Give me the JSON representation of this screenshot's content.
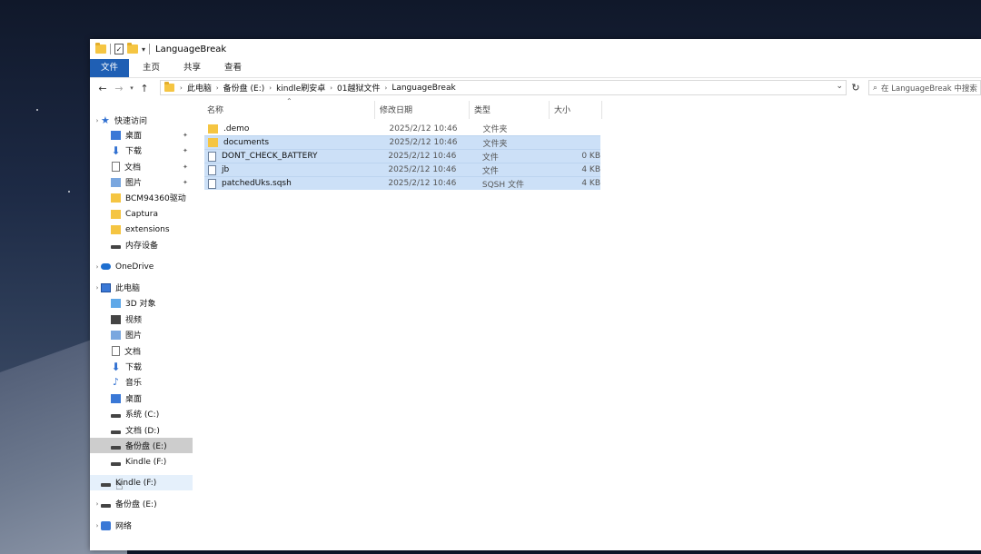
{
  "window": {
    "title": "LanguageBreak"
  },
  "ribbon": {
    "tabs": [
      "文件",
      "主页",
      "共享",
      "查看"
    ]
  },
  "address": {
    "crumbs": [
      "此电脑",
      "备份盘 (E:)",
      "kindle刷安卓",
      "01越狱文件",
      "LanguageBreak"
    ],
    "search_placeholder": "在 LanguageBreak 中搜索"
  },
  "sidebar": {
    "items": [
      {
        "label": "快速访问",
        "icon": "star-icon"
      },
      {
        "label": "桌面",
        "icon": "desktop-icon",
        "pinned": true
      },
      {
        "label": "下载",
        "icon": "download-icon",
        "pinned": true
      },
      {
        "label": "文档",
        "icon": "document-icon",
        "pinned": true
      },
      {
        "label": "图片",
        "icon": "pictures-icon",
        "pinned": true
      },
      {
        "label": "BCM94360驱动",
        "icon": "folder-icon"
      },
      {
        "label": "Captura",
        "icon": "folder-icon"
      },
      {
        "label": "extensions",
        "icon": "folder-icon"
      },
      {
        "label": "内存设备",
        "icon": "drive-icon"
      },
      {
        "label": "OneDrive",
        "icon": "cloud-icon"
      },
      {
        "label": "此电脑",
        "icon": "computer-icon"
      },
      {
        "label": "3D 对象",
        "icon": "3d-objects-icon"
      },
      {
        "label": "视频",
        "icon": "video-icon"
      },
      {
        "label": "图片",
        "icon": "pictures-icon"
      },
      {
        "label": "文档",
        "icon": "document-icon"
      },
      {
        "label": "下载",
        "icon": "download-icon"
      },
      {
        "label": "音乐",
        "icon": "music-icon"
      },
      {
        "label": "桌面",
        "icon": "desktop-icon"
      },
      {
        "label": "系统 (C:)",
        "icon": "drive-icon"
      },
      {
        "label": "文档 (D:)",
        "icon": "drive-icon"
      },
      {
        "label": "备份盘 (E:)",
        "icon": "drive-icon",
        "selected": true
      },
      {
        "label": "Kindle (F:)",
        "icon": "drive-icon"
      },
      {
        "label": "Kindle (F:)",
        "icon": "drive-icon",
        "hovered": true
      },
      {
        "label": "备份盘 (E:)",
        "icon": "drive-icon"
      },
      {
        "label": "网络",
        "icon": "network-icon"
      }
    ]
  },
  "columns": [
    "名称",
    "修改日期",
    "类型",
    "大小"
  ],
  "files": [
    {
      "name": ".demo",
      "date": "2025/2/12 10:46",
      "type": "文件夹",
      "size": "",
      "kind": "folder",
      "selected": false
    },
    {
      "name": "documents",
      "date": "2025/2/12 10:46",
      "type": "文件夹",
      "size": "",
      "kind": "folder",
      "selected": true
    },
    {
      "name": "DONT_CHECK_BATTERY",
      "date": "2025/2/12 10:46",
      "type": "文件",
      "size": "0 KB",
      "kind": "file",
      "selected": true
    },
    {
      "name": "jb",
      "date": "2025/2/12 10:46",
      "type": "文件",
      "size": "4 KB",
      "kind": "file",
      "selected": true
    },
    {
      "name": "patchedUks.sqsh",
      "date": "2025/2/12 10:46",
      "type": "SQSH 文件",
      "size": "4 KB",
      "kind": "file",
      "selected": true
    }
  ],
  "colors": {
    "accent": "#1f5fb4",
    "selection": "#cce0f7",
    "folder": "#f5c542"
  }
}
